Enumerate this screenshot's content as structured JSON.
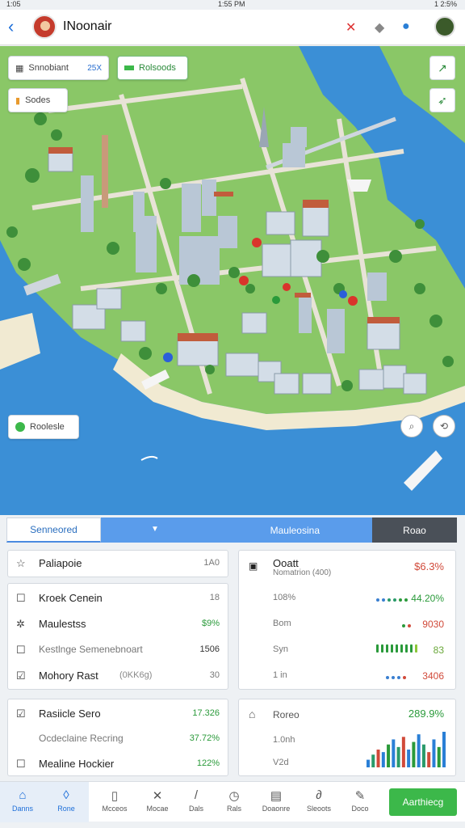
{
  "status_bar": {
    "left": "1:05",
    "center": "1:55 PM",
    "right": "1 2:5%"
  },
  "header": {
    "title": "INoonair",
    "icons": [
      "back-icon",
      "avatar",
      "close-flag-icon",
      "pin-icon",
      "globe-icon",
      "profile-icon"
    ]
  },
  "map": {
    "chips": [
      {
        "label": "Snnobiant",
        "value": "25X"
      },
      {
        "label": "Rolsoods"
      },
      {
        "label": "Sodes"
      }
    ],
    "bottom_chip": "Roolesle",
    "colors": {
      "water": "#3b8fd6",
      "land": "#8ac767",
      "road": "#e8e3d7"
    }
  },
  "tabs": [
    {
      "label": "Senneored"
    },
    {
      "label": "Mauleosina"
    },
    {
      "label": "Roao"
    }
  ],
  "left_card_top": {
    "label": "Paliapoie",
    "value": "1A0"
  },
  "left_card_list": [
    {
      "icon": "square-icon",
      "label": "Kroek Cenein",
      "value": "18"
    },
    {
      "icon": "gear-icon",
      "label": "Maulestss",
      "value": "$9%"
    },
    {
      "icon": "square-icon",
      "label": "Kestlnge Semenebnoart",
      "value": "1506"
    },
    {
      "icon": "check-icon",
      "label": "Mohory Rast",
      "extra": "(0KK6g)",
      "value": "30"
    }
  ],
  "right_card": {
    "title": "Ooatt",
    "subtitle": "Nomatrion (400)",
    "value": "$6.3%",
    "rows": [
      {
        "label": "108%",
        "value": "44.20%"
      },
      {
        "label": "Bom",
        "value": "9030"
      },
      {
        "label": "Syn",
        "value": "83"
      },
      {
        "label": "1 in",
        "value": "3406"
      }
    ]
  },
  "left_card_bottom": [
    {
      "icon": "check-icon",
      "label": "Rasiicle Sero",
      "value": "17.326"
    },
    {
      "icon": "",
      "label": "Ocdeclaine Recring",
      "value": "37.72%"
    },
    {
      "icon": "square-icon",
      "label": "Mealine Hockier",
      "value": "122%"
    }
  ],
  "right_card_bottom": {
    "icon": "tag-icon",
    "label": "Roreo",
    "value": "289.9%",
    "row2": "1.0nh",
    "row3": "V2d",
    "chart_values": [
      3,
      5,
      7,
      6,
      9,
      11,
      8,
      12,
      7,
      10,
      13,
      9,
      6,
      11,
      8,
      14
    ]
  },
  "nav": [
    {
      "icon": "home-icon",
      "label": "Danns"
    },
    {
      "icon": "drop-icon",
      "label": "Rone"
    },
    {
      "icon": "book-icon",
      "label": "Mcceos"
    },
    {
      "icon": "cross-icon",
      "label": "Mocae"
    },
    {
      "icon": "pen-icon",
      "label": "Dals"
    },
    {
      "icon": "clock-icon",
      "label": "Rals"
    },
    {
      "icon": "grid-icon",
      "label": "Doaonre"
    },
    {
      "icon": "leaf-icon",
      "label": "Sleoots"
    },
    {
      "icon": "edit-icon",
      "label": "Doco"
    }
  ],
  "cta_label": "Aarthiecg"
}
